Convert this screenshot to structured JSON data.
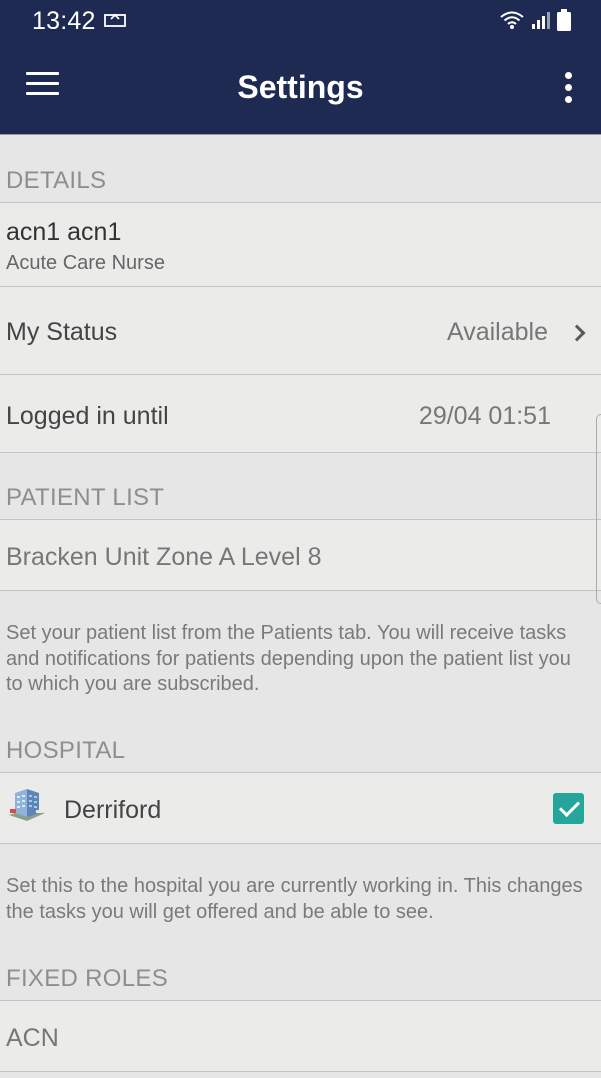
{
  "status_bar": {
    "time": "13:42",
    "icons": [
      "notification-icon",
      "wifi-icon",
      "signal-icon",
      "battery-icon"
    ]
  },
  "app_bar": {
    "title": "Settings",
    "menu_icon": "hamburger-menu-icon",
    "more_icon": "more-vertical-icon"
  },
  "details": {
    "header": "DETAILS",
    "user_name": "acn1 acn1",
    "user_role": "Acute Care Nurse",
    "status_label": "My Status",
    "status_value": "Available",
    "logged_label": "Logged in until",
    "logged_value": "29/04 01:51"
  },
  "patient_list": {
    "header": "PATIENT LIST",
    "current": "Bracken Unit Zone A Level 8",
    "help": "Set your patient list from the Patients tab. You will receive tasks and notifications for patients depending upon the patient list you to which you are subscribed."
  },
  "hospital": {
    "header": "HOSPITAL",
    "name": "Derriford",
    "checked": true,
    "help": "Set this to the hospital you are currently working in. This changes the tasks you will get offered and be able to see."
  },
  "fixed_roles": {
    "header": "FIXED ROLES",
    "items": [
      "ACN"
    ]
  },
  "colors": {
    "header_bg": "#1e2a52",
    "accent": "#26a69a",
    "row_bg": "#ebebea",
    "section_bg": "#e6e6e6"
  }
}
